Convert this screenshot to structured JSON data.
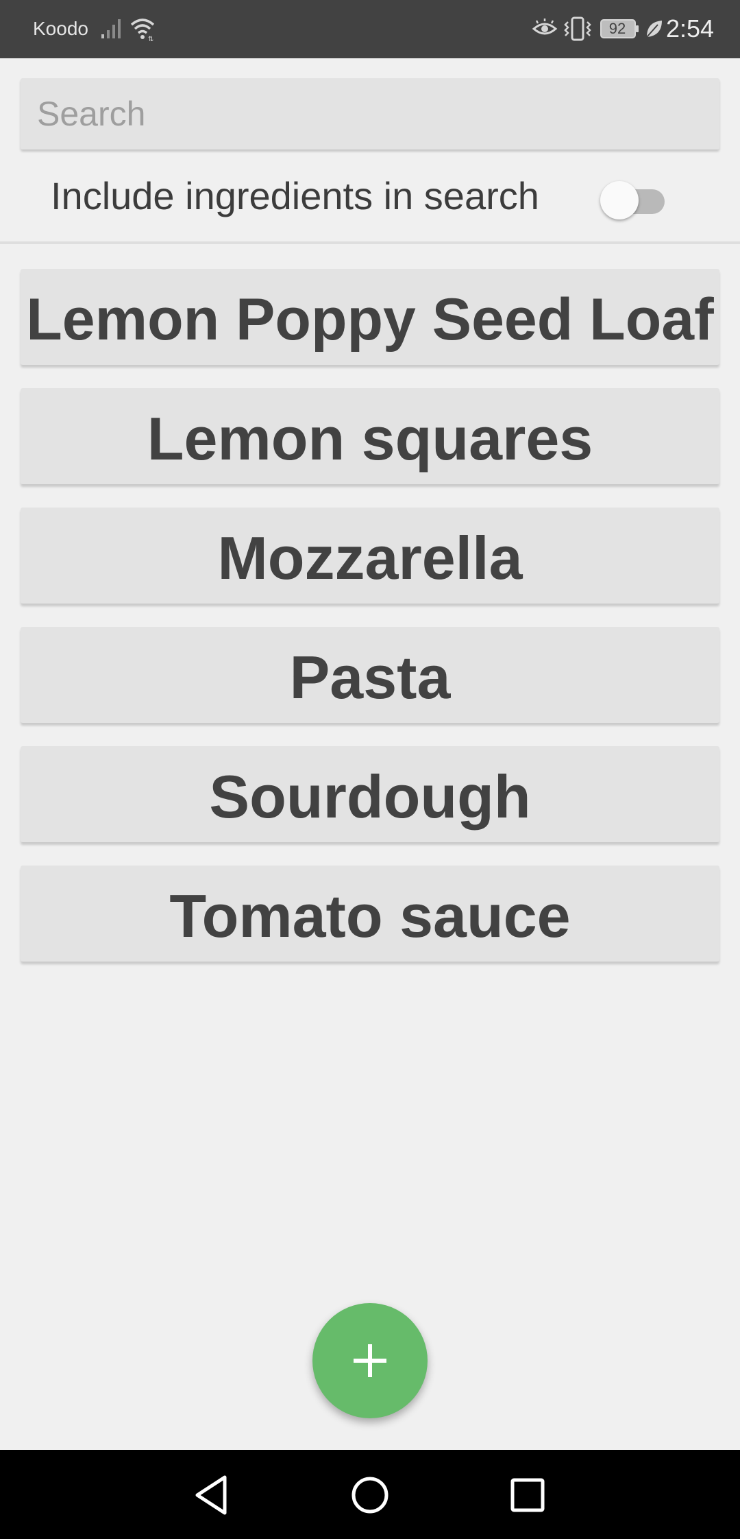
{
  "status_bar": {
    "carrier": "Koodo",
    "battery": "92",
    "time": "2:54",
    "icons": [
      "signal-icon",
      "wifi-icon",
      "eye-comfort-icon",
      "vibrate-icon",
      "battery-icon",
      "power-saver-leaf-icon"
    ]
  },
  "search": {
    "placeholder": "Search",
    "value": ""
  },
  "ingredients_toggle": {
    "label": "Include ingredients in search",
    "checked": false
  },
  "recipes": [
    {
      "label": "Lemon Poppy Seed Loaf"
    },
    {
      "label": "Lemon squares"
    },
    {
      "label": "Mozzarella"
    },
    {
      "label": "Pasta"
    },
    {
      "label": "Sourdough"
    },
    {
      "label": "Tomato sauce"
    }
  ],
  "fab": {
    "icon": "plus-icon",
    "color": "#66bb6a"
  },
  "nav_bar": {
    "buttons": [
      "back-icon",
      "home-icon",
      "recents-icon"
    ]
  },
  "colors": {
    "status_bar": "#424242",
    "background": "#f0f0f0",
    "card": "#e3e3e3",
    "text": "#424242",
    "nav_bar": "#000000"
  }
}
